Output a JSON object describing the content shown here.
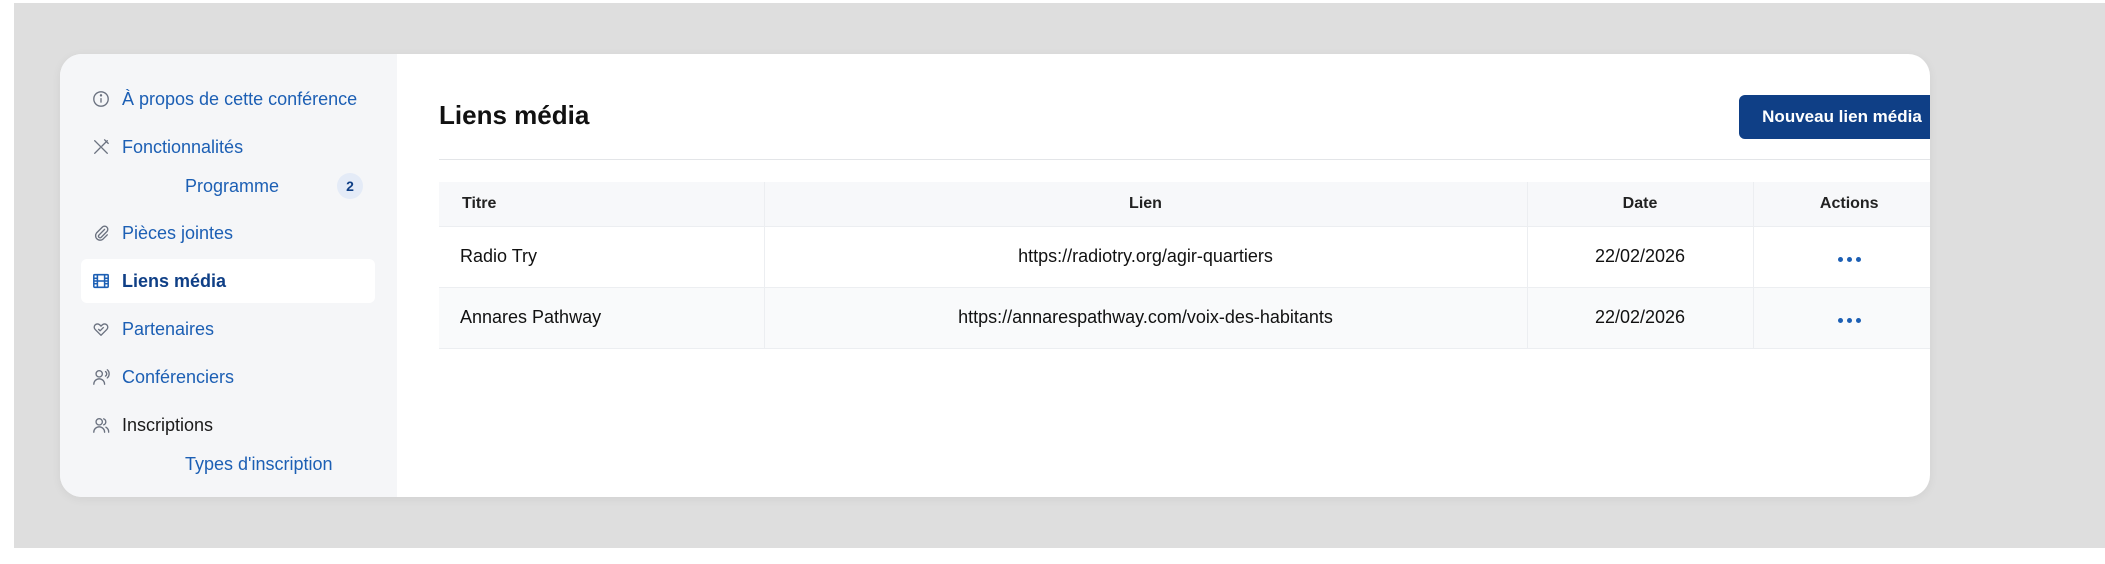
{
  "sidebar": {
    "items": [
      {
        "label": "À propos de cette conférence",
        "icon": "info-icon"
      },
      {
        "label": "Fonctionnalités",
        "icon": "tools-icon"
      },
      {
        "label": "Programme",
        "badge": "2"
      },
      {
        "label": "Pièces jointes",
        "icon": "paperclip-icon"
      },
      {
        "label": "Liens média",
        "icon": "film-icon",
        "active": true
      },
      {
        "label": "Partenaires",
        "icon": "handshake-heart-icon"
      },
      {
        "label": "Conférenciers",
        "icon": "speaker-icon"
      },
      {
        "label": "Inscriptions",
        "icon": "users-icon"
      },
      {
        "label": "Types d'inscription"
      }
    ]
  },
  "main": {
    "title": "Liens média",
    "new_button": "Nouveau lien média",
    "table": {
      "headers": [
        "Titre",
        "Lien",
        "Date",
        "Actions"
      ],
      "rows": [
        {
          "titre": "Radio Try",
          "lien": "https://radiotry.org/agir-quartiers",
          "date": "22/02/2026"
        },
        {
          "titre": "Annares Pathway",
          "lien": "https://annarespathway.com/voix-des-habitants",
          "date": "22/02/2026"
        }
      ]
    }
  },
  "colors": {
    "accent": "#1c5fb4",
    "primary_button": "#0f3f86",
    "sidebar_bg": "#f5f6f8",
    "backdrop": "#dedede"
  }
}
